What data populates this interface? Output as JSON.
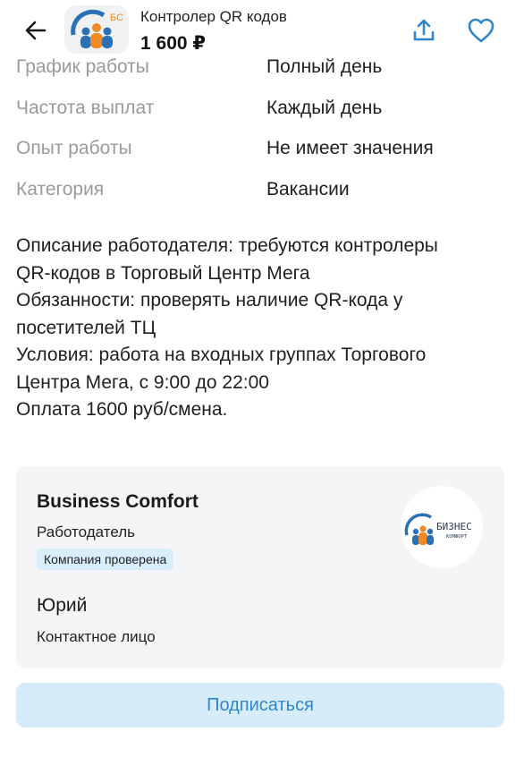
{
  "header": {
    "title": "Контролер QR кодов",
    "price": "1 600 ₽",
    "back_icon": "arrow-left-icon",
    "share_icon": "share-icon",
    "favorite_icon": "heart-icon"
  },
  "params": [
    {
      "key": "График работы",
      "value": "Полный день"
    },
    {
      "key": "Частота выплат",
      "value": "Каждый день"
    },
    {
      "key": "Опыт работы",
      "value": "Не имеет значения"
    },
    {
      "key": "Категория",
      "value": "Вакансии"
    }
  ],
  "description": {
    "lines": [
      "Описание работодателя: требуются контролеры",
      "QR-кодов в Торговый Центр Мега",
      "Обязанности: проверять наличие QR-кода у",
      "посетителей ТЦ",
      "Условия: работа на входных группах Торгового",
      "Центра Мега, с 9:00 до 22:00",
      "Оплата 1600 руб/смена."
    ]
  },
  "seller": {
    "name": "Business Comfort",
    "role": "Работодатель",
    "badge": "Компания проверена",
    "contact_name": "Юрий",
    "contact_role": "Контактное лицо",
    "logo_text_top": "БИЗНЕС",
    "logo_text_bottom": "КОМФОРТ",
    "thumb_text": "БС"
  },
  "actions": {
    "subscribe_label": "Подписаться"
  },
  "colors": {
    "accent": "#2f86c9",
    "badge_bg": "#d9eefb",
    "card_bg": "#f4f5f6",
    "logo_blue": "#2b6fb5",
    "logo_orange": "#f08a24"
  }
}
